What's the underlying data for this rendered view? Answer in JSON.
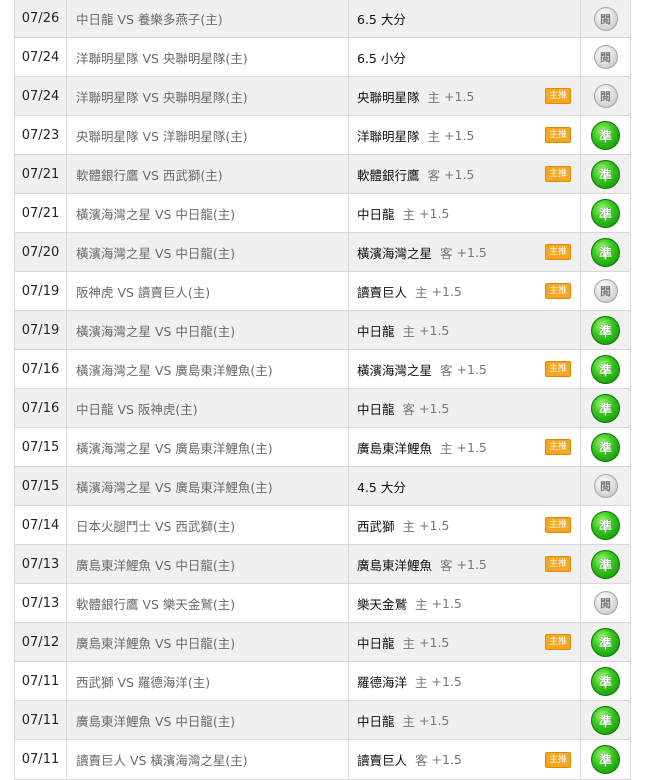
{
  "colors": {
    "badge": "#f5a623",
    "win_icon": "#32c21a",
    "pending_icon": "#cfcfcf",
    "row_alt": "#f0f0f0"
  },
  "rows": [
    {
      "date": "07/26",
      "match": "中日龍 VS 養樂多燕子(主)",
      "pick_team": "6.5 大分",
      "pick_side": "",
      "pick_line": "",
      "badge": "",
      "result": "閱",
      "result_type": "pending"
    },
    {
      "date": "07/24",
      "match": "洋聯明星隊 VS 央聯明星隊(主)",
      "pick_team": "6.5 小分",
      "pick_side": "",
      "pick_line": "",
      "badge": "",
      "result": "閱",
      "result_type": "pending"
    },
    {
      "date": "07/24",
      "match": "洋聯明星隊 VS 央聯明星隊(主)",
      "pick_team": "央聯明星隊",
      "pick_side": "主",
      "pick_line": "+1.5",
      "badge": "主推",
      "result": "閱",
      "result_type": "pending"
    },
    {
      "date": "07/23",
      "match": "央聯明星隊 VS 洋聯明星隊(主)",
      "pick_team": "洋聯明星隊",
      "pick_side": "主",
      "pick_line": "+1.5",
      "badge": "主推",
      "result": "準",
      "result_type": "win"
    },
    {
      "date": "07/21",
      "match": "軟體銀行鷹 VS 西武獅(主)",
      "pick_team": "軟體銀行鷹",
      "pick_side": "客",
      "pick_line": "+1.5",
      "badge": "主推",
      "result": "準",
      "result_type": "win"
    },
    {
      "date": "07/21",
      "match": "橫濱海灣之星 VS 中日龍(主)",
      "pick_team": "中日龍",
      "pick_side": "主",
      "pick_line": "+1.5",
      "badge": "",
      "result": "準",
      "result_type": "win"
    },
    {
      "date": "07/20",
      "match": "橫濱海灣之星 VS 中日龍(主)",
      "pick_team": "橫濱海灣之星",
      "pick_side": "客",
      "pick_line": "+1.5",
      "badge": "主推",
      "result": "準",
      "result_type": "win"
    },
    {
      "date": "07/19",
      "match": "阪神虎 VS 讀賣巨人(主)",
      "pick_team": "讀賣巨人",
      "pick_side": "主",
      "pick_line": "+1.5",
      "badge": "主推",
      "result": "閱",
      "result_type": "pending"
    },
    {
      "date": "07/19",
      "match": "橫濱海灣之星 VS 中日龍(主)",
      "pick_team": "中日龍",
      "pick_side": "主",
      "pick_line": "+1.5",
      "badge": "",
      "result": "準",
      "result_type": "win"
    },
    {
      "date": "07/16",
      "match": "橫濱海灣之星 VS 廣島東洋鯉魚(主)",
      "pick_team": "橫濱海灣之星",
      "pick_side": "客",
      "pick_line": "+1.5",
      "badge": "主推",
      "result": "準",
      "result_type": "win"
    },
    {
      "date": "07/16",
      "match": "中日龍 VS 阪神虎(主)",
      "pick_team": "中日龍",
      "pick_side": "客",
      "pick_line": "+1.5",
      "badge": "",
      "result": "準",
      "result_type": "win"
    },
    {
      "date": "07/15",
      "match": "橫濱海灣之星 VS 廣島東洋鯉魚(主)",
      "pick_team": "廣島東洋鯉魚",
      "pick_side": "主",
      "pick_line": "+1.5",
      "badge": "主推",
      "result": "準",
      "result_type": "win"
    },
    {
      "date": "07/15",
      "match": "橫濱海灣之星 VS 廣島東洋鯉魚(主)",
      "pick_team": "4.5 大分",
      "pick_side": "",
      "pick_line": "",
      "badge": "",
      "result": "閱",
      "result_type": "pending"
    },
    {
      "date": "07/14",
      "match": "日本火腿鬥士 VS 西武獅(主)",
      "pick_team": "西武獅",
      "pick_side": "主",
      "pick_line": "+1.5",
      "badge": "主推",
      "result": "準",
      "result_type": "win"
    },
    {
      "date": "07/13",
      "match": "廣島東洋鯉魚 VS 中日龍(主)",
      "pick_team": "廣島東洋鯉魚",
      "pick_side": "客",
      "pick_line": "+1.5",
      "badge": "主推",
      "result": "準",
      "result_type": "win"
    },
    {
      "date": "07/13",
      "match": "軟體銀行鷹 VS 樂天金鷲(主)",
      "pick_team": "樂天金鷲",
      "pick_side": "主",
      "pick_line": "+1.5",
      "badge": "",
      "result": "閱",
      "result_type": "pending"
    },
    {
      "date": "07/12",
      "match": "廣島東洋鯉魚 VS 中日龍(主)",
      "pick_team": "中日龍",
      "pick_side": "主",
      "pick_line": "+1.5",
      "badge": "主推",
      "result": "準",
      "result_type": "win"
    },
    {
      "date": "07/11",
      "match": "西武獅 VS 羅德海洋(主)",
      "pick_team": "羅德海洋",
      "pick_side": "主",
      "pick_line": "+1.5",
      "badge": "",
      "result": "準",
      "result_type": "win"
    },
    {
      "date": "07/11",
      "match": "廣島東洋鯉魚 VS 中日龍(主)",
      "pick_team": "中日龍",
      "pick_side": "主",
      "pick_line": "+1.5",
      "badge": "",
      "result": "準",
      "result_type": "win"
    },
    {
      "date": "07/11",
      "match": "讀賣巨人 VS 橫濱海灣之星(主)",
      "pick_team": "讀賣巨人",
      "pick_side": "客",
      "pick_line": "+1.5",
      "badge": "主推",
      "result": "準",
      "result_type": "win"
    }
  ]
}
